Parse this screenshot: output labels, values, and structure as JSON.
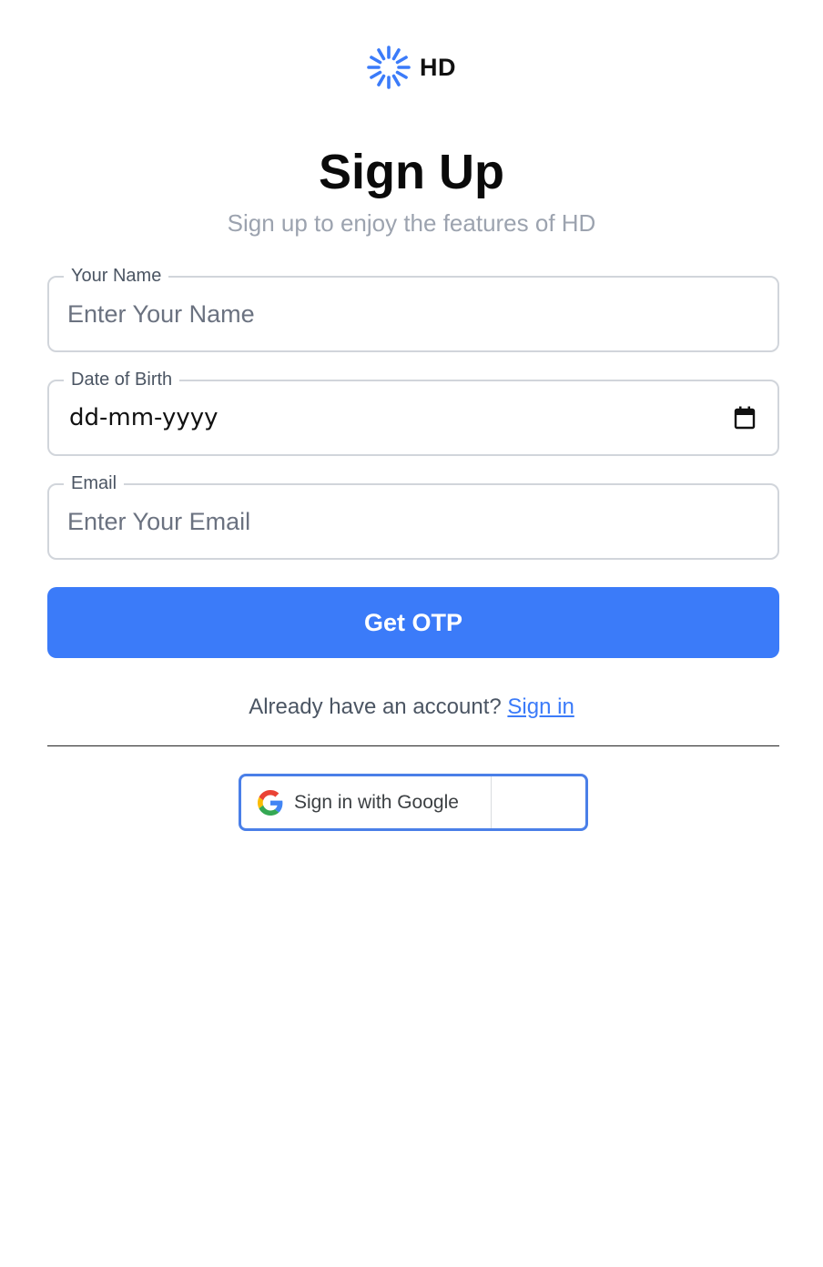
{
  "brand": {
    "name": "HD",
    "accent_color": "#3b7bf9"
  },
  "header": {
    "title": "Sign Up",
    "subtitle": "Sign up to enjoy the features of HD"
  },
  "form": {
    "name": {
      "label": "Your Name",
      "placeholder": "Enter Your Name",
      "value": ""
    },
    "dob": {
      "label": "Date of Birth",
      "value": "dd-mm-yyyy",
      "icon": "calendar-icon"
    },
    "email": {
      "label": "Email",
      "placeholder": "Enter Your Email",
      "value": ""
    },
    "submit_label": "Get OTP"
  },
  "footer": {
    "prompt": "Already have an account?",
    "signin_link": "Sign in",
    "google_button_label": "Sign in with Google",
    "google_icon": "google-logo-icon"
  }
}
